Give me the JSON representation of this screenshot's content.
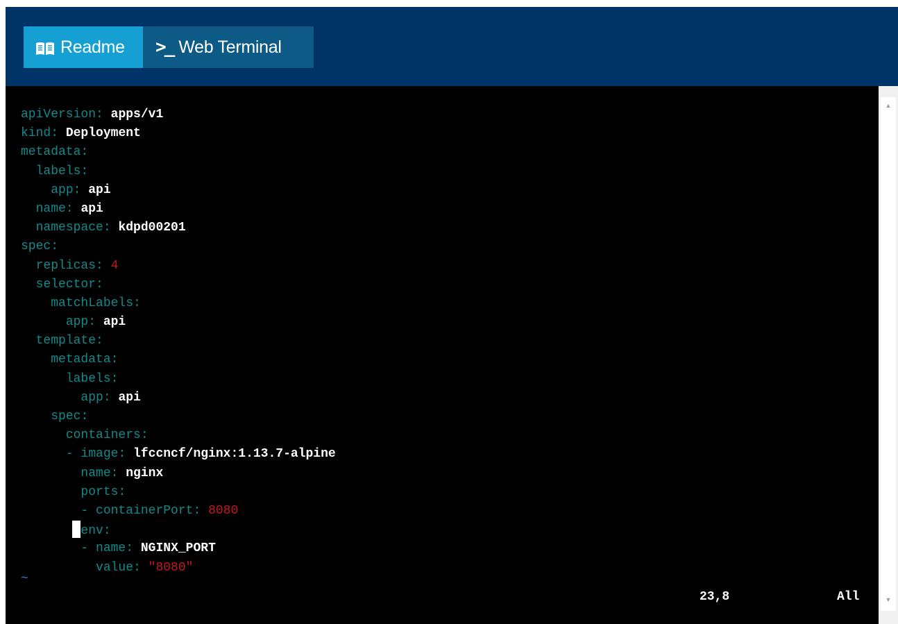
{
  "tabs": {
    "readme_label": "Readme",
    "terminal_label": "Web Terminal",
    "terminal_prompt": ">_"
  },
  "editor": {
    "lines": [
      {
        "indent": "",
        "key": "apiVersion",
        "sep": ": ",
        "value": "apps/v1",
        "vtype": "str"
      },
      {
        "indent": "",
        "key": "kind",
        "sep": ": ",
        "value": "Deployment",
        "vtype": "str"
      },
      {
        "indent": "",
        "key": "metadata",
        "sep": ":",
        "value": "",
        "vtype": "str"
      },
      {
        "indent": "  ",
        "key": "labels",
        "sep": ":",
        "value": "",
        "vtype": "str"
      },
      {
        "indent": "    ",
        "key": "app",
        "sep": ": ",
        "value": "api",
        "vtype": "str"
      },
      {
        "indent": "  ",
        "key": "name",
        "sep": ": ",
        "value": "api",
        "vtype": "str"
      },
      {
        "indent": "  ",
        "key": "namespace",
        "sep": ": ",
        "value": "kdpd00201",
        "vtype": "str"
      },
      {
        "indent": "",
        "key": "spec",
        "sep": ":",
        "value": "",
        "vtype": "str"
      },
      {
        "indent": "  ",
        "key": "replicas",
        "sep": ": ",
        "value": "4",
        "vtype": "num"
      },
      {
        "indent": "  ",
        "key": "selector",
        "sep": ":",
        "value": "",
        "vtype": "str"
      },
      {
        "indent": "    ",
        "key": "matchLabels",
        "sep": ":",
        "value": "",
        "vtype": "str"
      },
      {
        "indent": "      ",
        "key": "app",
        "sep": ": ",
        "value": "api",
        "vtype": "str"
      },
      {
        "indent": "  ",
        "key": "template",
        "sep": ":",
        "value": "",
        "vtype": "str"
      },
      {
        "indent": "    ",
        "key": "metadata",
        "sep": ":",
        "value": "",
        "vtype": "str"
      },
      {
        "indent": "      ",
        "key": "labels",
        "sep": ":",
        "value": "",
        "vtype": "str"
      },
      {
        "indent": "        ",
        "key": "app",
        "sep": ": ",
        "value": "api",
        "vtype": "str"
      },
      {
        "indent": "    ",
        "key": "spec",
        "sep": ":",
        "value": "",
        "vtype": "str"
      },
      {
        "indent": "      ",
        "key": "containers",
        "sep": ":",
        "value": "",
        "vtype": "str"
      },
      {
        "indent": "      ",
        "dash": "- ",
        "key": "image",
        "sep": ": ",
        "value": "lfccncf/nginx:1.13.7-alpine",
        "vtype": "str"
      },
      {
        "indent": "        ",
        "key": "name",
        "sep": ": ",
        "value": "nginx",
        "vtype": "str"
      },
      {
        "indent": "        ",
        "key": "ports",
        "sep": ":",
        "value": "",
        "vtype": "str"
      },
      {
        "indent": "        ",
        "dash": "- ",
        "key": "containerPort",
        "sep": ": ",
        "value": "8080",
        "vtype": "num"
      },
      {
        "indent": "        ",
        "key": "env",
        "sep": ":",
        "value": "",
        "vtype": "str",
        "cursor": true
      },
      {
        "indent": "        ",
        "dash": "- ",
        "key": "name",
        "sep": ": ",
        "value": "NGINX_PORT",
        "vtype": "str"
      },
      {
        "indent": "          ",
        "key": "value",
        "sep": ": ",
        "value": "\"8080\"",
        "vtype": "num"
      }
    ],
    "empty_line_marker": "~",
    "status_position": "23,8",
    "status_scope": "All"
  },
  "colors": {
    "header_bg": "#003366",
    "readme_tab_bg": "#169fd3",
    "terminal_tab_bg": "#0d5a86",
    "yaml_key": "#118a8a",
    "yaml_number": "#c4171b",
    "yaml_value": "#ffffff"
  }
}
